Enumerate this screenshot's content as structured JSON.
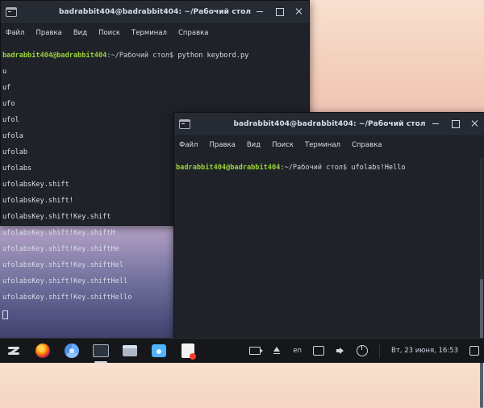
{
  "windows": {
    "back": {
      "title": "badrabbit404@badrabbit404: ~/Рабочий стол",
      "menu": [
        "Файл",
        "Правка",
        "Вид",
        "Поиск",
        "Терминал",
        "Справка"
      ],
      "prompt_user": "badrabbit404@badrabbit404",
      "prompt_path": ":~/Рабочий стол$",
      "command": " python keybord.py",
      "output_lines": [
        "u",
        "uf",
        "ufo",
        "ufol",
        "ufola",
        "ufolab",
        "ufolabs",
        "ufolabsKey.shift",
        "ufolabsKey.shift!",
        "ufolabsKey.shift!Key.shift",
        "ufolabsKey.shift!Key.shiftH",
        "ufolabsKey.shift!Key.shiftHe",
        "ufolabsKey.shift!Key.shiftHel",
        "ufolabsKey.shift!Key.shiftHell",
        "ufolabsKey.shift!Key.shiftHello"
      ]
    },
    "front": {
      "title": "badrabbit404@badrabbit404: ~/Рабочий стол",
      "menu": [
        "Файл",
        "Правка",
        "Вид",
        "Поиск",
        "Терминал",
        "Справка"
      ],
      "prompt_user": "badrabbit404@badrabbit404",
      "prompt_path": ":~/Рабочий стол$",
      "command": " ufolabs!Hello"
    }
  },
  "taskbar": {
    "lang": "en",
    "datetime": "Вт, 23 июня, 16:53"
  }
}
